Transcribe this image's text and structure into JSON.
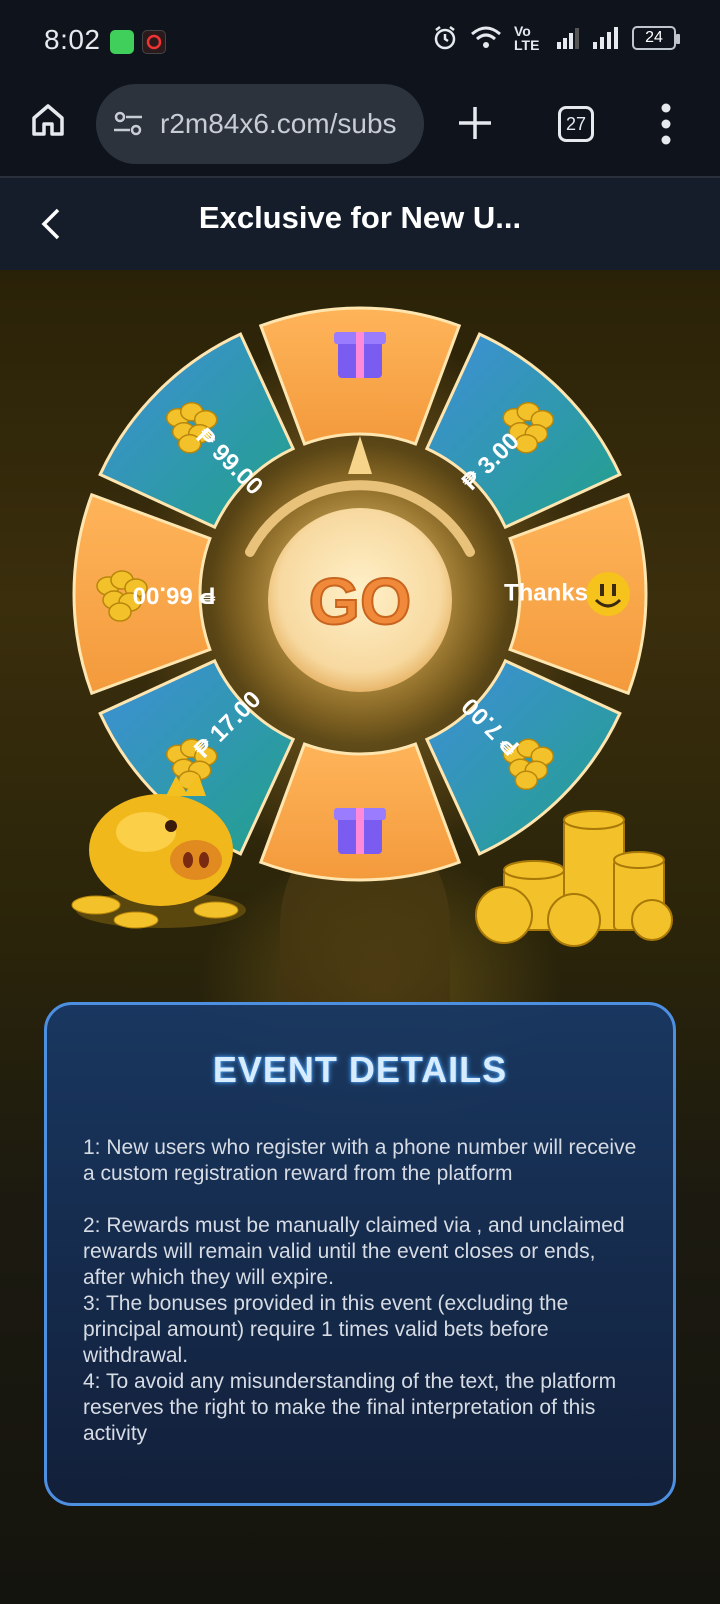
{
  "status_bar": {
    "time": "8:02",
    "network": "Vo LTE",
    "battery": "24"
  },
  "browser": {
    "url": "r2m84x6.com/subs",
    "tab_count": "27"
  },
  "page": {
    "title": "Exclusive for New U..."
  },
  "wheel": {
    "center_label": "GO",
    "segments": [
      {
        "label": "",
        "type": "gift"
      },
      {
        "label": "₱ 3.00",
        "type": "coins"
      },
      {
        "label": "Thanks",
        "type": "emoji"
      },
      {
        "label": "₱ 7.00",
        "type": "coins"
      },
      {
        "label": "",
        "type": "gift"
      },
      {
        "label": "₱ 17.00",
        "type": "coins"
      },
      {
        "label": "₱ 66.00",
        "type": "coins"
      },
      {
        "label": "₱ 99.00",
        "type": "coins"
      }
    ]
  },
  "event": {
    "title": "EVENT DETAILS",
    "rules": [
      "1: New users who register with a phone number will receive a custom registration reward from the platform",
      "2: Rewards must be manually claimed via , and unclaimed rewards will remain valid until the event closes or ends, after which they will expire.",
      "3: The bonuses provided in this event (excluding the principal amount) require 1 times valid bets before withdrawal.",
      "4: To avoid any misunderstanding of the text, the platform reserves the right to make the final interpretation of this activity"
    ]
  },
  "colors": {
    "orange": "#f5a54a",
    "teal": "#2a98a8",
    "blue": "#3a82d0",
    "gold": "#f2c230",
    "panel_border": "#4d8fe0"
  }
}
